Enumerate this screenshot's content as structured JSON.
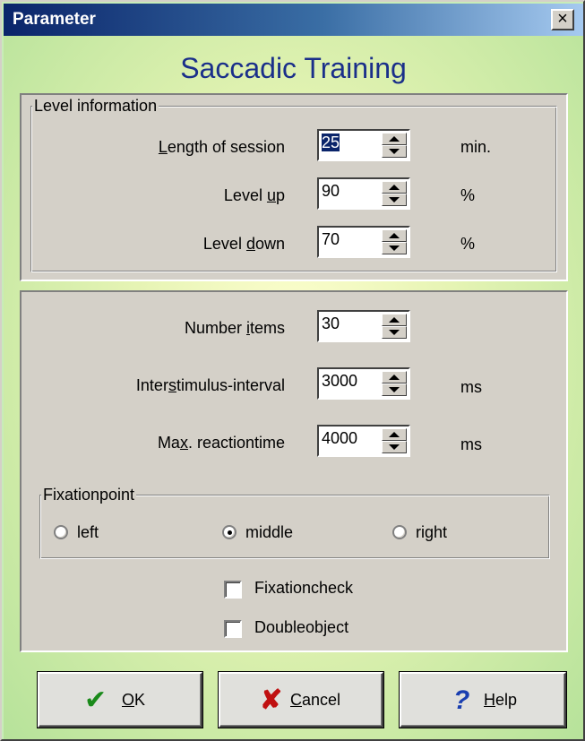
{
  "window": {
    "title": "Parameter",
    "close_glyph": "×"
  },
  "heading": "Saccadic Training",
  "level_info": {
    "legend": "Level information",
    "rows": [
      {
        "label_pre": "",
        "label_ul": "L",
        "label_post": "ength of session",
        "value": "25",
        "unit": "min."
      },
      {
        "label_pre": "Level ",
        "label_ul": "u",
        "label_post": "p",
        "value": "90",
        "unit": "%"
      },
      {
        "label_pre": "Level ",
        "label_ul": "d",
        "label_post": "own",
        "value": "70",
        "unit": "%"
      }
    ]
  },
  "settings": {
    "rows": [
      {
        "label_pre": "Number ",
        "label_ul": "i",
        "label_post": "tems",
        "value": "30",
        "unit": ""
      },
      {
        "label_pre": "Inter",
        "label_ul": "s",
        "label_post": "timulus-interval",
        "value": "3000",
        "unit": "ms"
      },
      {
        "label_pre": "Ma",
        "label_ul": "x",
        "label_post": ". reactiontime",
        "value": "4000",
        "unit": "ms"
      }
    ],
    "fixationpoint": {
      "legend": "Fixationpoint",
      "options": [
        "left",
        "middle",
        "right"
      ],
      "selected": "middle"
    },
    "checkboxes": [
      {
        "label": "Fixationcheck",
        "checked": false
      },
      {
        "label": "Doubleobject",
        "checked": false
      }
    ]
  },
  "buttons": {
    "ok": {
      "ul": "O",
      "rest": "K",
      "icon": "checkmark-icon",
      "color": "#1a8a1a"
    },
    "cancel": {
      "ul": "C",
      "rest": "ancel",
      "icon": "x-icon",
      "color": "#c01010"
    },
    "help": {
      "ul": "H",
      "rest": "elp",
      "icon": "question-icon",
      "color": "#1a3fb0"
    }
  }
}
